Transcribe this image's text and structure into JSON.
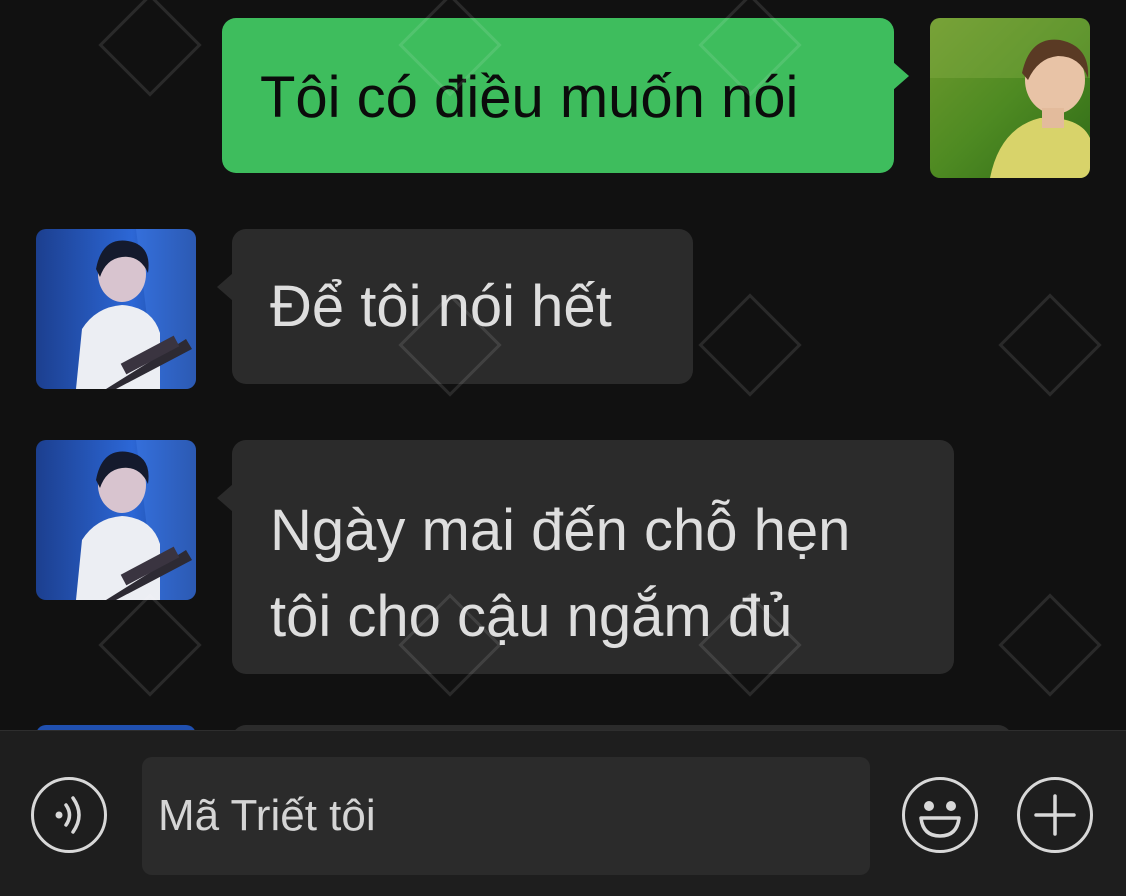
{
  "messages": [
    {
      "id": "m1",
      "direction": "outgoing",
      "lines": [
        "Tôi có điều muốn nói"
      ]
    },
    {
      "id": "m2",
      "direction": "incoming",
      "lines": [
        "Để tôi nói hết"
      ]
    },
    {
      "id": "m3",
      "direction": "incoming",
      "lines": [
        "Ngày mai đến chỗ hẹn",
        "tôi cho cậu ngắm đủ"
      ]
    }
  ],
  "input": {
    "value": "Mã Triết tôi"
  },
  "icons": {
    "voice": "voice-icon",
    "emoji": "emoji-icon",
    "plus": "plus-icon"
  },
  "colors": {
    "background": "#111111",
    "outgoing_bubble": "#3ebd5d",
    "incoming_bubble": "#2b2b2b",
    "input_bar": "#1e1e1e"
  }
}
